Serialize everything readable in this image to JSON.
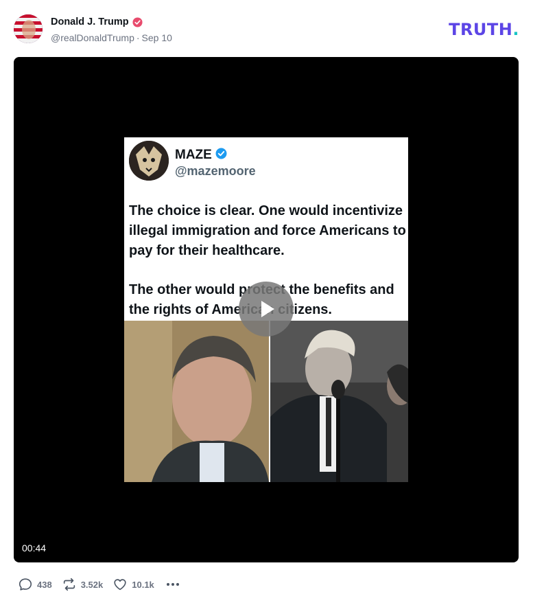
{
  "post": {
    "author_name": "Donald J. Trump",
    "handle": "@realDonaldTrump",
    "date": "Sep 10",
    "separator": "·"
  },
  "brand": {
    "name": "TRUTH",
    "suffix": ".",
    "color": "#5c45e6",
    "accent": "#17c4c4"
  },
  "video": {
    "duration": "00:44",
    "embedded_tweet": {
      "name": "MAZE",
      "handle": "@mazemoore",
      "paragraph1": "The choice is clear. One would incentivize illegal immigration and force Americans to pay for their healthcare.",
      "paragraph2": "The other would protect the benefits and the rights of American citizens."
    }
  },
  "actions": {
    "replies": "438",
    "retruths": "3.52k",
    "likes": "10.1k"
  },
  "icons": [
    "verified-badge-icon",
    "play-icon",
    "reply-icon",
    "retruth-icon",
    "like-icon",
    "more-icon"
  ]
}
